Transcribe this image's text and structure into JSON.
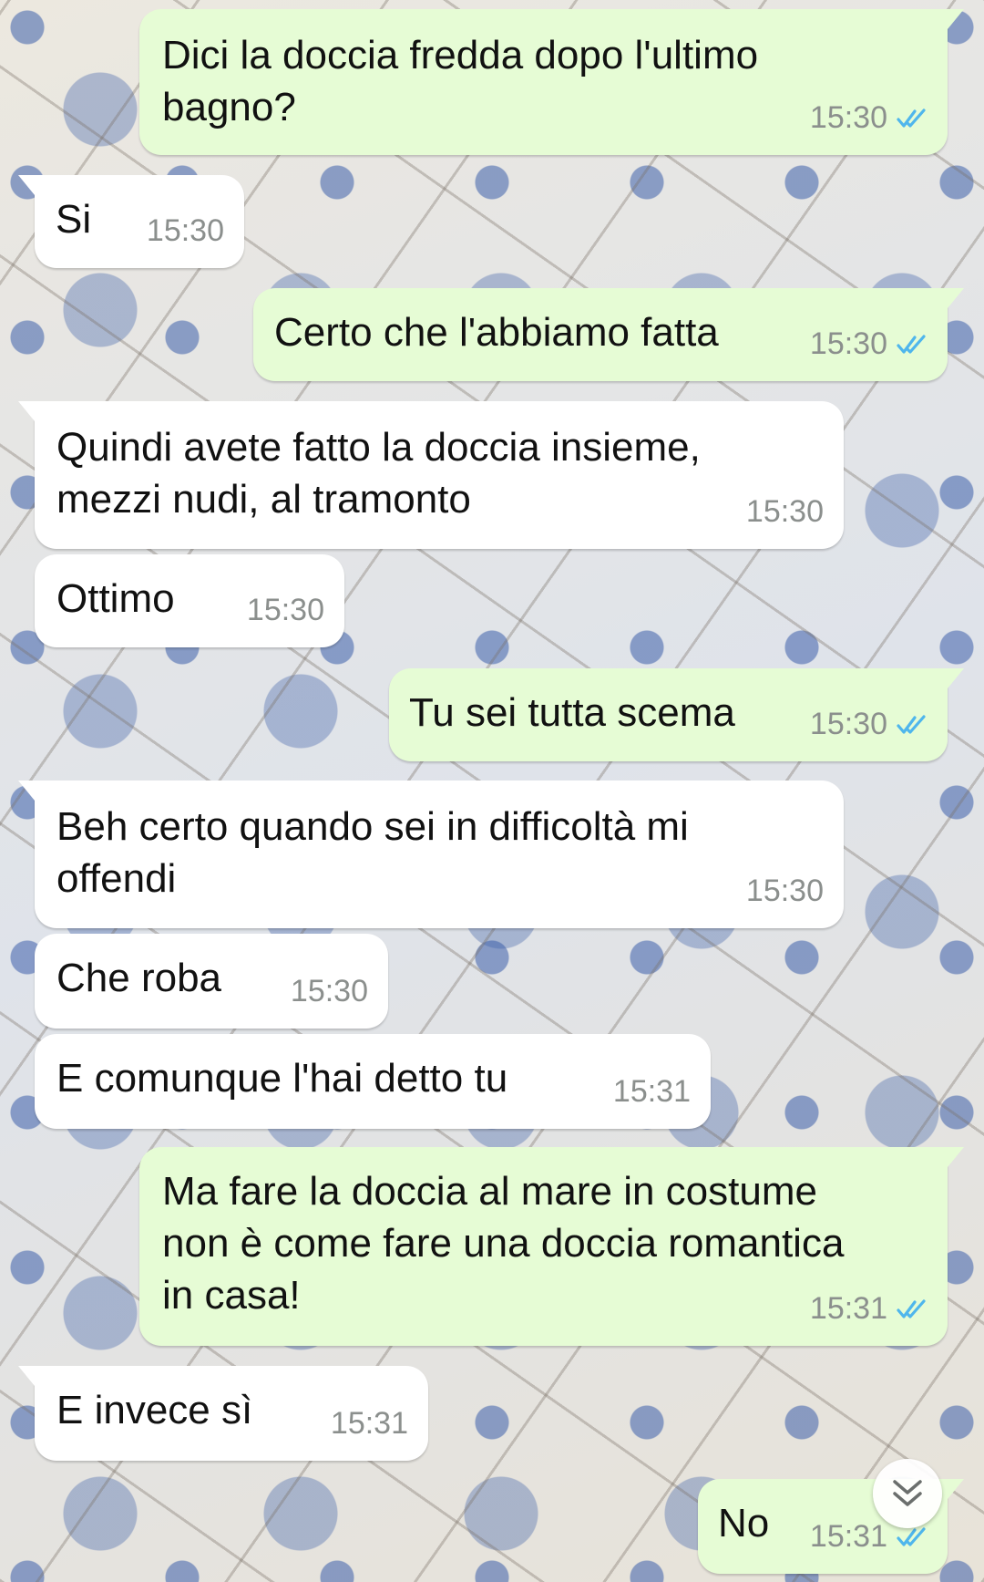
{
  "colors": {
    "incoming_bubble": "#ffffff",
    "outgoing_bubble": "#e6fcd5",
    "read_ticks": "#4fb6ec",
    "timestamp": "#8b8f8d"
  },
  "messages": [
    {
      "direction": "out",
      "text": "Dici la doccia fredda dopo l'ultimo\nbagno?",
      "time": "15:30",
      "status": "read"
    },
    {
      "direction": "in",
      "text": "Si",
      "time": "15:30"
    },
    {
      "direction": "out",
      "text": "Certo che l'abbiamo fatta",
      "time": "15:30",
      "status": "read"
    },
    {
      "direction": "in",
      "text": "Quindi avete fatto la doccia insieme,\nmezzi nudi, al tramonto",
      "time": "15:30"
    },
    {
      "direction": "in",
      "text": "Ottimo",
      "time": "15:30"
    },
    {
      "direction": "out",
      "text": "Tu sei tutta scema",
      "time": "15:30",
      "status": "read"
    },
    {
      "direction": "in",
      "text": "Beh certo quando sei in difficoltà mi\noffendi",
      "time": "15:30"
    },
    {
      "direction": "in",
      "text": "Che roba",
      "time": "15:30"
    },
    {
      "direction": "in",
      "text": "E comunque l'hai detto tu",
      "time": "15:31"
    },
    {
      "direction": "out",
      "text": "Ma fare la doccia al mare in costume\nnon è come fare una doccia romantica\nin casa!",
      "time": "15:31",
      "status": "read"
    },
    {
      "direction": "in",
      "text": "E invece sì",
      "time": "15:31"
    },
    {
      "direction": "out",
      "text": "No",
      "time": "15:31",
      "status": "read"
    }
  ],
  "scroll_button": {
    "icon": "double-chevron-down-icon"
  }
}
